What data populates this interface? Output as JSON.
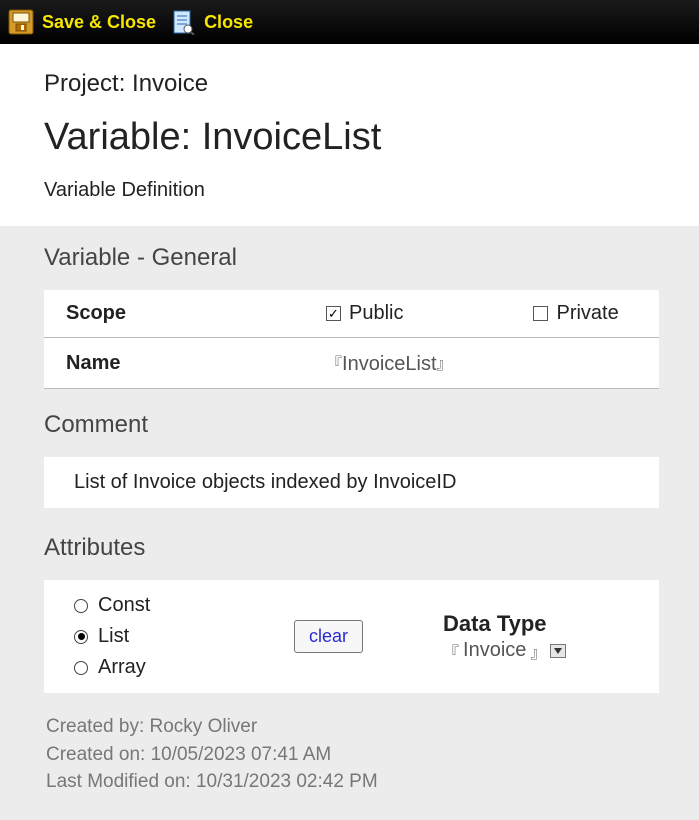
{
  "toolbar": {
    "save_close": "Save & Close",
    "close": "Close"
  },
  "header": {
    "project_prefix": "Project: ",
    "project_name": "Invoice",
    "variable_prefix": "Variable: ",
    "variable_name": "InvoiceList",
    "subtitle": "Variable Definition"
  },
  "sections": {
    "general_title": "Variable - General",
    "scope_label": "Scope",
    "public_label": "Public",
    "public_checked": true,
    "private_label": "Private",
    "private_checked": false,
    "name_label": "Name",
    "name_value": "InvoiceList",
    "comment_title": "Comment",
    "comment_value": "List of Invoice objects indexed by InvoiceID",
    "attributes_title": "Attributes",
    "radios": {
      "const": "Const",
      "list": "List",
      "array": "Array",
      "selected": "list"
    },
    "clear_label": "clear",
    "data_type_label": "Data Type",
    "data_type_value": "Invoice"
  },
  "footer": {
    "created_by_label": "Created by: ",
    "created_by": "Rocky Oliver",
    "created_on_label": "Created on: ",
    "created_on": "10/05/2023 07:41 AM",
    "modified_on_label": "Last Modified on: ",
    "modified_on": "10/31/2023 02:42 PM"
  }
}
